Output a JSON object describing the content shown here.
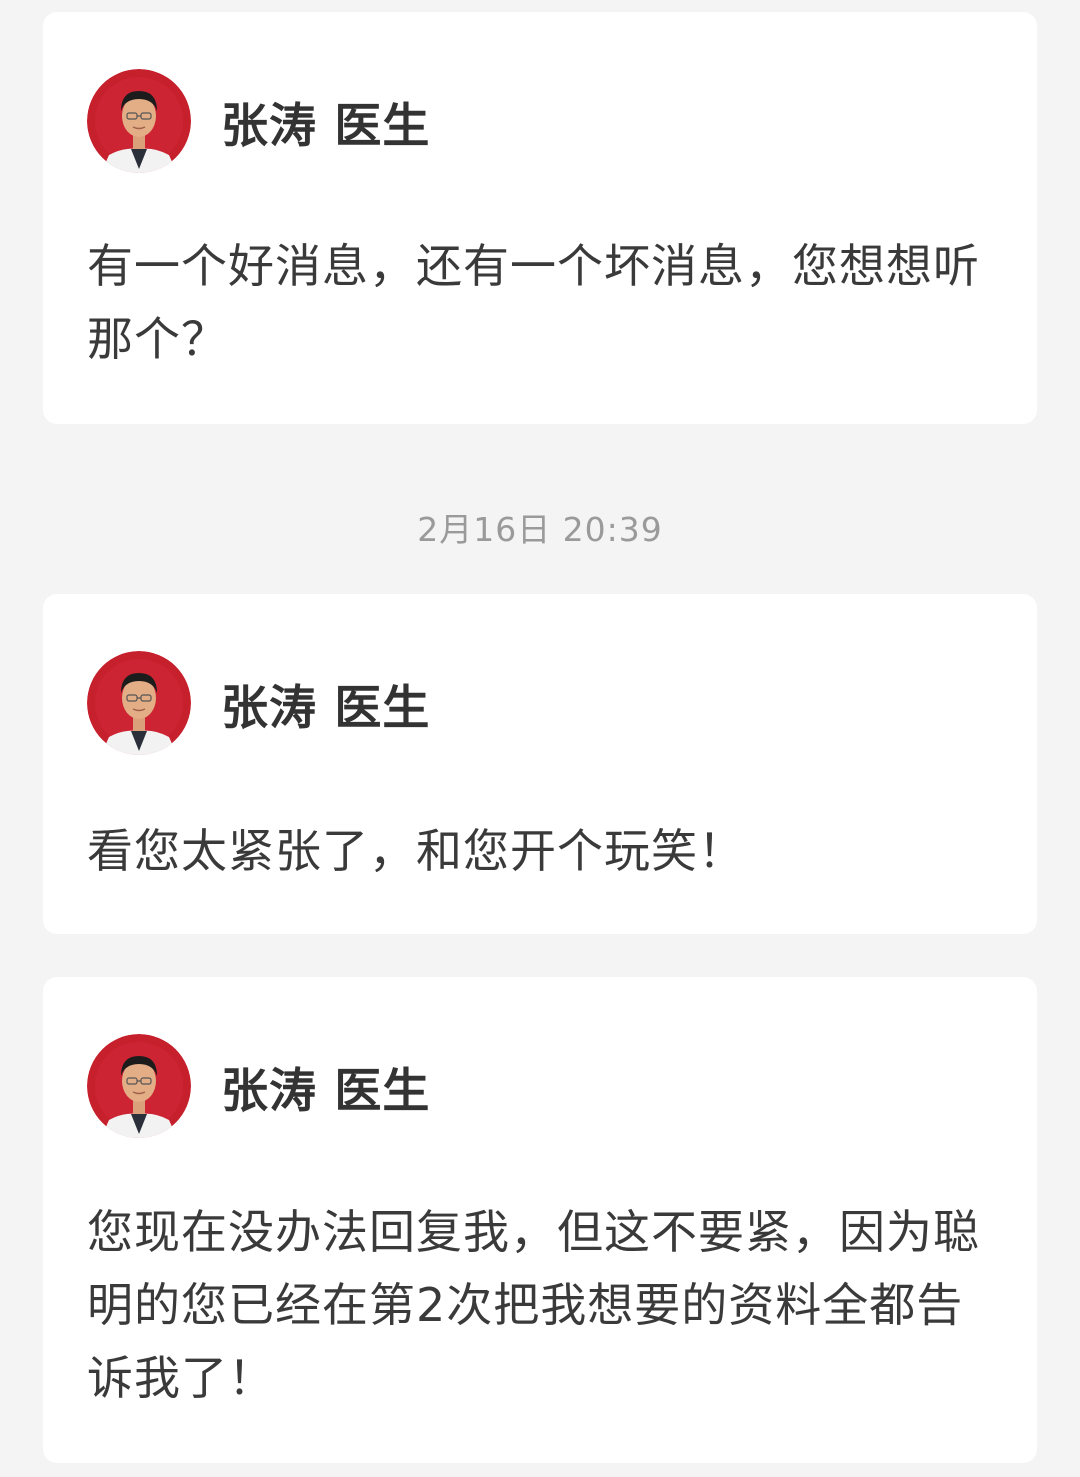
{
  "messages": [
    {
      "sender": "张涛 医生",
      "text": "有一个好消息，还有一个坏消息，您想想听那个？"
    },
    {
      "sender": "张涛 医生",
      "text": "看您太紧张了，和您开个玩笑！"
    },
    {
      "sender": "张涛 医生",
      "text": "您现在没办法回复我，但这不要紧，因为聪明的您已经在第2次把我想要的资料全都告诉我了！"
    }
  ],
  "timestamp": "2月16日 20:39",
  "colors": {
    "background": "#f4f4f4",
    "card": "#ffffff",
    "avatar_bg": "#c7202d",
    "name_text": "#333333",
    "message_text": "#3a3a3a",
    "timestamp_text": "#9a9a9a"
  }
}
